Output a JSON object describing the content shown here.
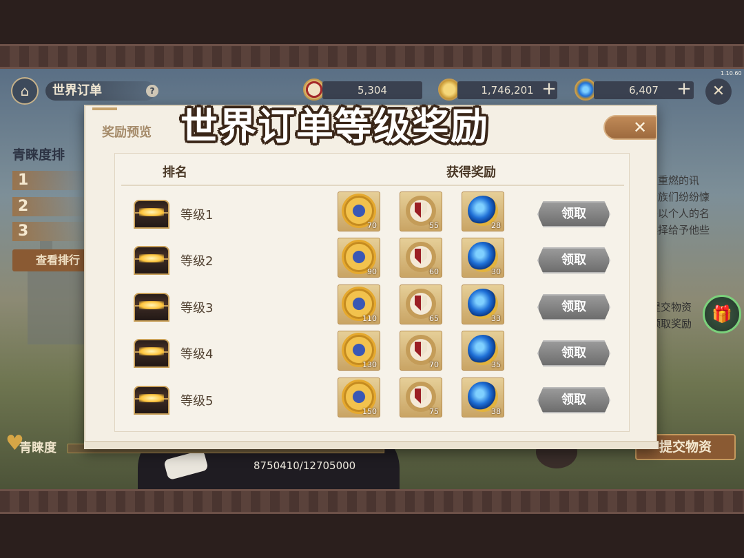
{
  "hud": {
    "title": "世界订单",
    "help": "?",
    "resources": [
      {
        "name": "shield-coin",
        "value": "5,304",
        "plus": ""
      },
      {
        "name": "gold-coin",
        "value": "1,746,201",
        "plus": "+"
      },
      {
        "name": "blue-gem",
        "value": "6,407",
        "plus": "+"
      }
    ],
    "version": "1.10.60",
    "close_glyph": "✕"
  },
  "background": {
    "favor_board": "青睐度排",
    "ranks": [
      "1",
      "2",
      "3"
    ],
    "view_ranking": "查看排行",
    "right_text": [
      "火重燃的讯",
      "贵族们纷纷慷",
      "将以个人的名",
      "选择给予他些"
    ],
    "submit_hint": [
      "提交物资",
      "领取奖励"
    ],
    "favor_label": "青睐度",
    "progress": "8750410/12705000",
    "submit_button": "提交物资"
  },
  "modal": {
    "header": "奖励预览",
    "title": "世界订单等级奖励",
    "close_glyph": "✕",
    "col_rank": "排名",
    "col_reward": "获得奖励",
    "claim_label": "领取",
    "rows": [
      {
        "label": "等级1",
        "star": "70",
        "shield": "55",
        "gem": "28"
      },
      {
        "label": "等级2",
        "star": "90",
        "shield": "60",
        "gem": "30"
      },
      {
        "label": "等级3",
        "star": "110",
        "shield": "65",
        "gem": "33"
      },
      {
        "label": "等级4",
        "star": "130",
        "shield": "70",
        "gem": "35"
      },
      {
        "label": "等级5",
        "star": "150",
        "shield": "75",
        "gem": "38"
      }
    ]
  },
  "colors": {
    "accent": "#9d6a3e",
    "panel": "#f4efe4",
    "button_disabled": "#7a7a7a"
  }
}
